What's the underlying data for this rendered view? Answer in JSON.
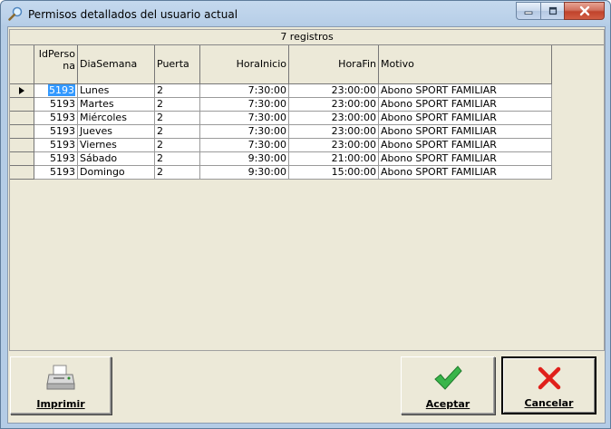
{
  "window": {
    "title": "Permisos detallados del usuario actual",
    "icons": {
      "title": "magnifier-icon",
      "minimize": "minimize-icon",
      "maximize": "maximize-icon",
      "close": "close-icon"
    }
  },
  "grid": {
    "caption": "7 registros",
    "columns": [
      {
        "key": "id",
        "label": "IdPersona"
      },
      {
        "key": "dia",
        "label": "DiaSemana"
      },
      {
        "key": "puerta",
        "label": "Puerta"
      },
      {
        "key": "inicio",
        "label": "HoraInicio"
      },
      {
        "key": "fin",
        "label": "HoraFin"
      },
      {
        "key": "motivo",
        "label": "Motivo"
      }
    ],
    "rows": [
      {
        "id": "5193",
        "dia": "Lunes",
        "puerta": "2",
        "inicio": "7:30:00",
        "fin": "23:00:00",
        "motivo": "Abono SPORT FAMILIAR"
      },
      {
        "id": "5193",
        "dia": "Martes",
        "puerta": "2",
        "inicio": "7:30:00",
        "fin": "23:00:00",
        "motivo": "Abono SPORT FAMILIAR"
      },
      {
        "id": "5193",
        "dia": "Miércoles",
        "puerta": "2",
        "inicio": "7:30:00",
        "fin": "23:00:00",
        "motivo": "Abono SPORT FAMILIAR"
      },
      {
        "id": "5193",
        "dia": "Jueves",
        "puerta": "2",
        "inicio": "7:30:00",
        "fin": "23:00:00",
        "motivo": "Abono SPORT FAMILIAR"
      },
      {
        "id": "5193",
        "dia": "Viernes",
        "puerta": "2",
        "inicio": "7:30:00",
        "fin": "23:00:00",
        "motivo": "Abono SPORT FAMILIAR"
      },
      {
        "id": "5193",
        "dia": "Sábado",
        "puerta": "2",
        "inicio": "9:30:00",
        "fin": "21:00:00",
        "motivo": "Abono SPORT FAMILIAR"
      },
      {
        "id": "5193",
        "dia": "Domingo",
        "puerta": "2",
        "inicio": "9:30:00",
        "fin": "15:00:00",
        "motivo": "Abono SPORT FAMILIAR"
      }
    ],
    "current_row": 0
  },
  "buttons": {
    "print": {
      "label": "Imprimir",
      "icon": "printer-icon"
    },
    "accept": {
      "label": "Aceptar",
      "icon": "checkmark-icon"
    },
    "cancel": {
      "label": "Cancelar",
      "icon": "x-icon"
    }
  }
}
